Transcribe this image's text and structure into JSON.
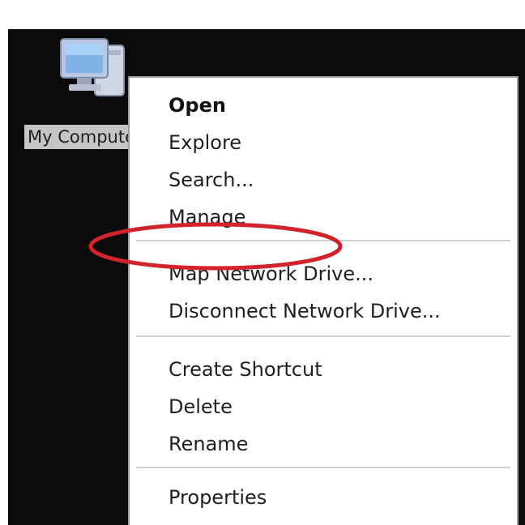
{
  "desktop": {
    "icon": {
      "name": "computer-icon",
      "label": "My Computer"
    }
  },
  "context_menu": {
    "groups": [
      [
        "Open",
        "Explore",
        "Search...",
        "Manage"
      ],
      [
        "Map Network Drive...",
        "Disconnect Network Drive..."
      ],
      [
        "Create Shortcut",
        "Delete",
        "Rename"
      ],
      [
        "Properties"
      ]
    ]
  },
  "annotation": {
    "highlight_color": "#d3232a",
    "highlighted_item": "Manage"
  },
  "colors": {
    "desktop_background": "#0b0b0b",
    "menu_background": "#ffffff",
    "menu_border": "#9d9d9d",
    "label_background": "#c5c5c5"
  }
}
